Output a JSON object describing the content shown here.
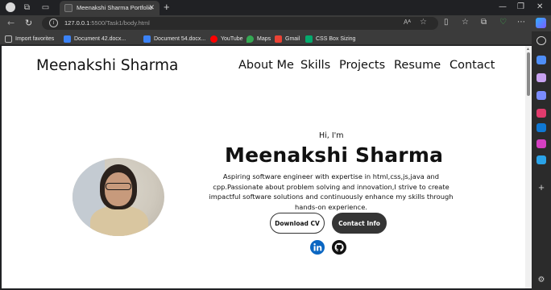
{
  "browser": {
    "tab_title": "Meenakshi Sharma Portfolio",
    "address": {
      "host": "127.0.0.1",
      "path": ":5500/Task1/body.html"
    },
    "read_aloud_label": "Aᴬ"
  },
  "bookmarks": [
    {
      "label": "Import favorites",
      "icon": "import-icon",
      "color": "#bdbdbd"
    },
    {
      "label": "Document 42.docx...",
      "icon": "word-doc-icon",
      "color": "#3b82f6"
    },
    {
      "label": "Document 54.docx...",
      "icon": "word-doc-icon",
      "color": "#3b82f6"
    },
    {
      "label": "YouTube",
      "icon": "youtube-icon",
      "color": "#ff0000"
    },
    {
      "label": "Maps",
      "icon": "maps-icon",
      "color": "#34a853"
    },
    {
      "label": "Gmail",
      "icon": "gmail-icon",
      "color": "#ea4335"
    },
    {
      "label": "CSS Box Sizing",
      "icon": "w3schools-icon",
      "color": "#04aa6d"
    }
  ],
  "page": {
    "brand": "Meenakshi Sharma",
    "nav": [
      "About Me",
      "Skills",
      "Projects",
      "Resume",
      "Contact"
    ],
    "greeting": "Hi, I'm",
    "name": "Meenakshi Sharma",
    "bio": "Aspiring software engineer with expertise in html,css,js,java and cpp.Passionate about problem solving and innovation,I strive to create impactful software solutions and continuously enhance my skills through hands-on experience.",
    "buttons": {
      "download": "Download CV",
      "contact": "Contact Info"
    },
    "social": [
      {
        "name": "linkedin-icon",
        "color": "#0a66c2"
      },
      {
        "name": "github-icon",
        "color": "#111111"
      }
    ]
  },
  "colors": {
    "chrome_dark": "#202124",
    "chrome_mid": "#3b3b3b",
    "page_bg": "#ffffff",
    "button_dark": "#353535"
  }
}
